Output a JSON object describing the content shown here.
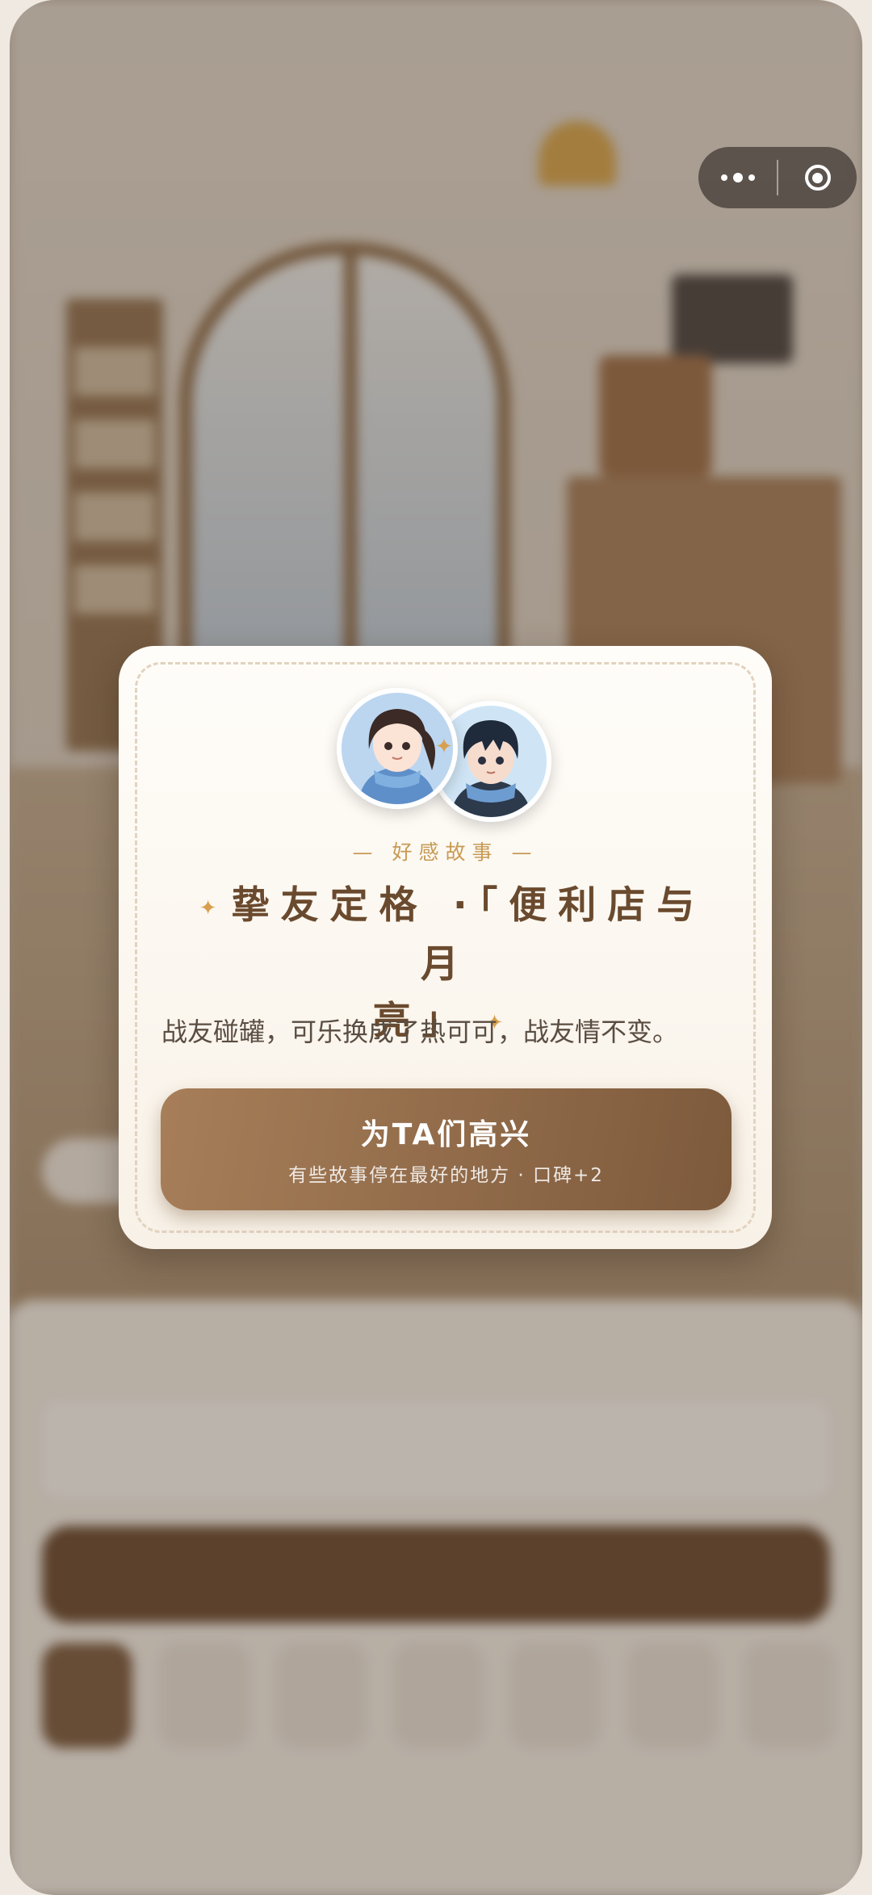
{
  "capsule": {
    "more_icon": "more-dots-icon",
    "close_icon": "target-close-icon"
  },
  "story_card": {
    "tag": "— 好感故事 —",
    "title_line1": "挚友定格 ·「便利店与月",
    "title_line2": "亮」",
    "description": "战友碰罐，可乐换成了热可可，战友情不变。",
    "button_label": "为TA们高兴",
    "button_sub": "有些故事停在最好的地方 · 口碑+2",
    "accent": "#d8a04e",
    "button_color": "#8b6646"
  }
}
